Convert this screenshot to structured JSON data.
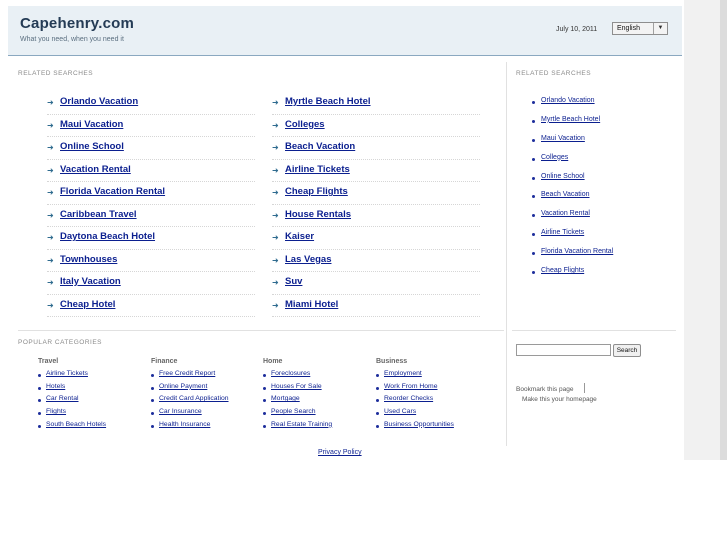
{
  "header": {
    "title": "Capehenry.com",
    "tagline": "What you need, when you need it",
    "date": "July 10, 2011",
    "language": "English"
  },
  "main": {
    "label": "RELATED SEARCHES",
    "left": [
      "Orlando Vacation",
      "Maui Vacation",
      "Online School",
      "Vacation Rental",
      "Florida Vacation Rental",
      "Caribbean Travel",
      "Daytona Beach Hotel",
      "Townhouses",
      "Italy Vacation",
      "Cheap Hotel"
    ],
    "right": [
      "Myrtle Beach Hotel",
      "Colleges",
      "Beach Vacation",
      "Airline Tickets",
      "Cheap Flights",
      "House Rentals",
      "Kaiser",
      "Las Vegas",
      "Suv",
      "Miami Hotel"
    ]
  },
  "sidebar": {
    "label": "RELATED SEARCHES",
    "items": [
      "Orlando Vacation",
      "Myrtle Beach Hotel",
      "Maui Vacation",
      "Colleges",
      "Online School",
      "Beach Vacation",
      "Vacation Rental",
      "Airline Tickets",
      "Florida Vacation Rental",
      "Cheap Flights"
    ],
    "search_button": "Search",
    "bookmark": "Bookmark this page",
    "homepage": "Make this your homepage"
  },
  "popular": {
    "label": "POPULAR CATEGORIES",
    "columns": [
      {
        "head": "Travel",
        "items": [
          "Airline Tickets",
          "Hotels",
          "Car Rental",
          "Flights",
          "South Beach Hotels"
        ]
      },
      {
        "head": "Finance",
        "items": [
          "Free Credit Report",
          "Online Payment",
          "Credit Card Application",
          "Car Insurance",
          "Health Insurance"
        ]
      },
      {
        "head": "Home",
        "items": [
          "Foreclosures",
          "Houses For Sale",
          "Mortgage",
          "People Search",
          "Real Estate Training"
        ]
      },
      {
        "head": "Business",
        "items": [
          "Employment",
          "Work From Home",
          "Reorder Checks",
          "Used Cars",
          "Business Opportunities"
        ]
      }
    ]
  },
  "footer": {
    "privacy": "Privacy Policy"
  }
}
